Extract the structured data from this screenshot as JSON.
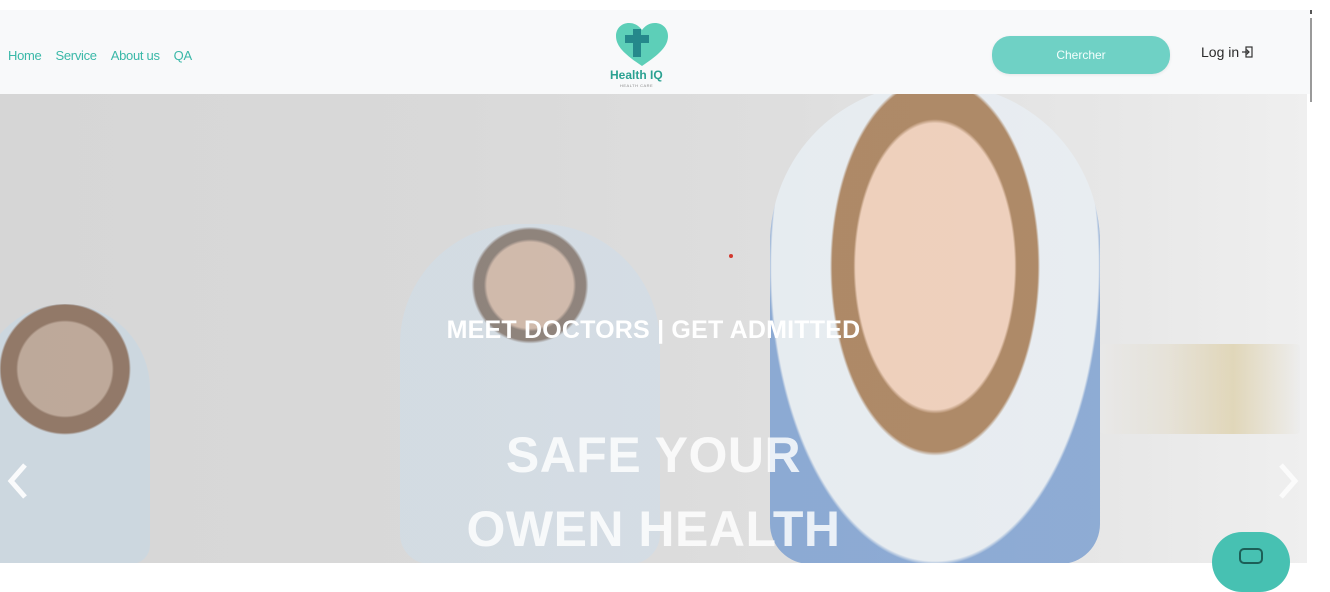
{
  "nav": {
    "links": [
      "Home",
      "Service",
      "About us",
      "QA"
    ]
  },
  "logo": {
    "title": "Health IQ",
    "subtitle": "HEALTH CARE"
  },
  "search": {
    "placeholder": "Chercher"
  },
  "login": {
    "label": "Log in"
  },
  "hero": {
    "subtitle": "MEET DOCTORS  |  GET ADMITTED",
    "title_line1": "SAFE YOUR",
    "title_line2": "OWEN HEALTH"
  },
  "colors": {
    "accent": "#3ab8a8",
    "search_bg": "#6fd1c5",
    "logo_teal": "#2aa191",
    "chat_button": "#47c1b2"
  },
  "icons": {
    "login": "login-arrow-icon",
    "prev": "chevron-left-icon",
    "next": "chevron-right-icon",
    "chat": "chat-icon"
  }
}
